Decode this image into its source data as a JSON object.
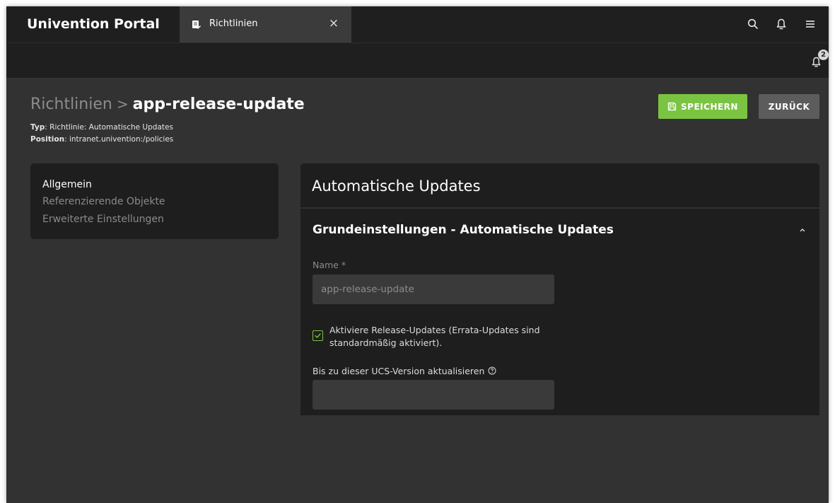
{
  "header": {
    "portal_title": "Univention Portal",
    "tab_label": "Richtlinien",
    "tab_close": "×",
    "icons": [
      "search-icon",
      "bell-icon",
      "menu-icon"
    ]
  },
  "notifications": {
    "count": "2"
  },
  "title": {
    "parent": "Richtlinien",
    "separator": ">",
    "current": "app-release-update",
    "type_label": "Typ",
    "type_value": ": Richtlinie: Automatische Updates",
    "position_label": "Position",
    "position_value": ": intranet.univention:/policies"
  },
  "actions": {
    "save_label": "SPEICHERN",
    "back_label": "ZURÜCK"
  },
  "nav": {
    "items": [
      {
        "label": "Allgemein",
        "active": true
      },
      {
        "label": "Referenzierende Objekte",
        "active": false
      },
      {
        "label": "Erweiterte Einstellungen",
        "active": false
      }
    ]
  },
  "panel": {
    "title": "Automatische Updates",
    "section_title": "Grundeinstellungen - Automatische Updates",
    "name_label": "Name *",
    "name_value": "app-release-update",
    "checkbox_checked": true,
    "checkbox_label": "Aktiviere Release-Updates (Errata-Updates sind standardmäßig aktiviert).",
    "version_label": "Bis zu dieser UCS-Version aktualisieren",
    "version_value": ""
  },
  "colors": {
    "accent_green": "#7bc442",
    "header_bg": "#1f1f1f",
    "page_bg": "#323232",
    "card_bg": "#1e1e1e"
  }
}
